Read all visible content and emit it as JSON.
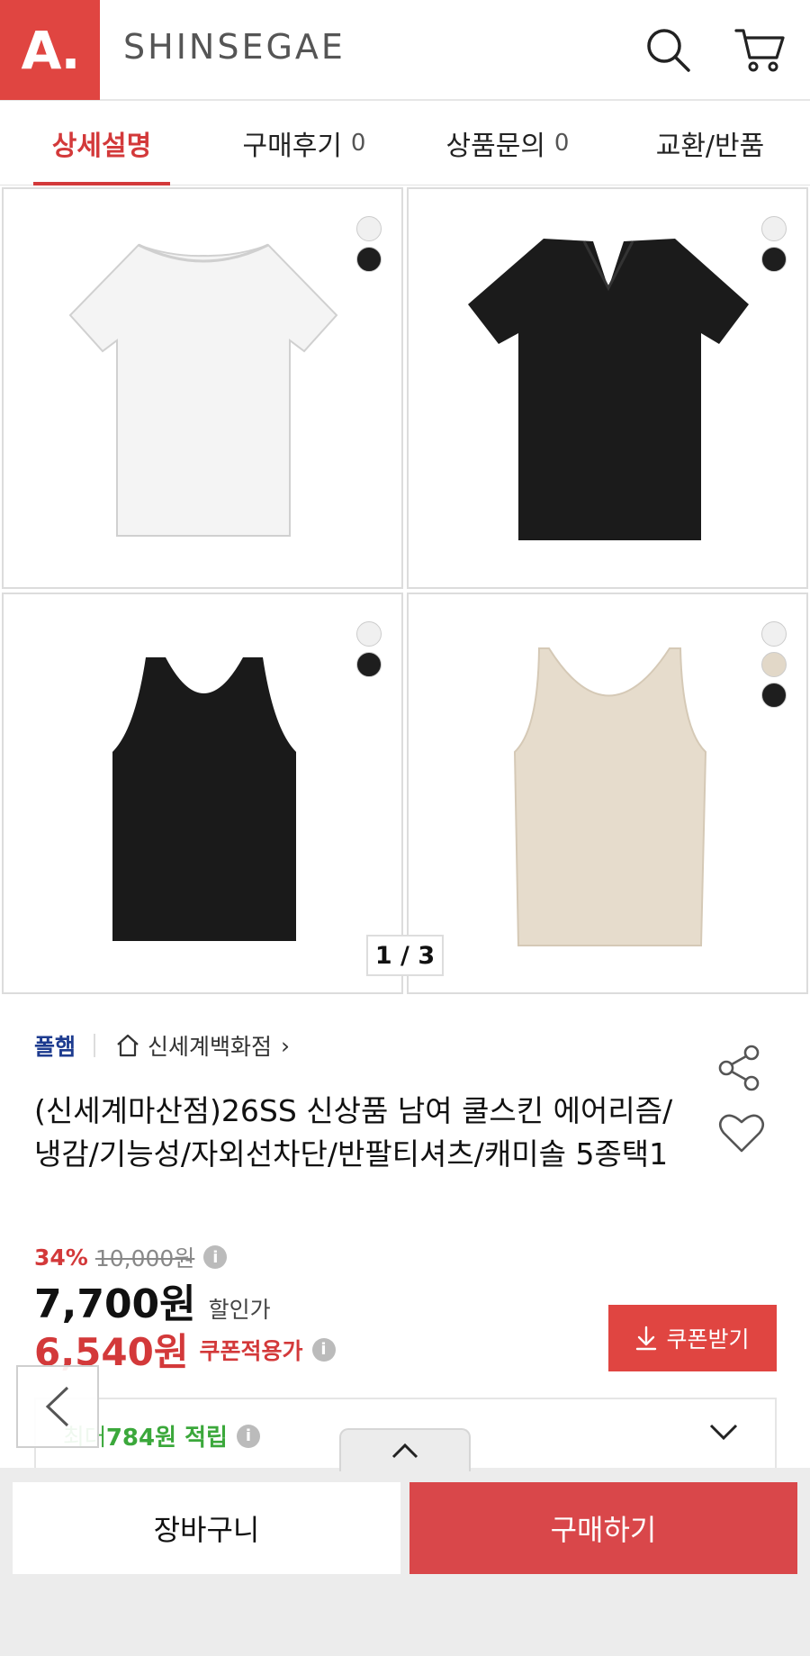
{
  "header": {
    "logo_text": "A.",
    "brand": "SHINSEGAE",
    "icons": [
      "search-icon",
      "cart-icon"
    ]
  },
  "tabs": [
    {
      "label": "상세설명",
      "count": ""
    },
    {
      "label": "구매후기",
      "count": "0"
    },
    {
      "label": "상품문의",
      "count": "0"
    },
    {
      "label": "교환/반품",
      "count": ""
    }
  ],
  "gallery": {
    "pager": "1 / 3",
    "products": [
      {
        "name": "white-crew-tee",
        "swatches": [
          "#f0f0f0",
          "#1e1e1e"
        ]
      },
      {
        "name": "black-vneck-tee",
        "swatches": [
          "#f0f0f0",
          "#1e1e1e"
        ]
      },
      {
        "name": "black-tank",
        "swatches": [
          "#f0f0f0",
          "#1e1e1e"
        ]
      },
      {
        "name": "beige-tank",
        "swatches": [
          "#f0f0f0",
          "#e2d8c8",
          "#1e1e1e"
        ]
      }
    ]
  },
  "product": {
    "brand": "폴햄",
    "store": "신세계백화점",
    "store_arrow": "›",
    "title": "(신세계마산점)26SS 신상품 남여 쿨스킨 에어리즘/냉감/기능성/자외선차단/반팔티셔츠/캐미솔 5종택1",
    "discount_rate": "34%",
    "original_price": "10,000원",
    "sale_price": "7,700원",
    "sale_label": "할인가",
    "coupon_price": "6,540원",
    "coupon_label": "쿠폰적용가",
    "coupon_button": "쿠폰받기",
    "points_prefix": "최대 ",
    "points_amount": "784원",
    "points_suffix": " 적립",
    "info_glyph": "i"
  },
  "bottom": {
    "cart_button": "장바구니",
    "buy_button": "구매하기"
  },
  "colors": {
    "accent": "#e04541",
    "brand_blue": "#1d3b8f",
    "points_green": "#3ba83b"
  }
}
